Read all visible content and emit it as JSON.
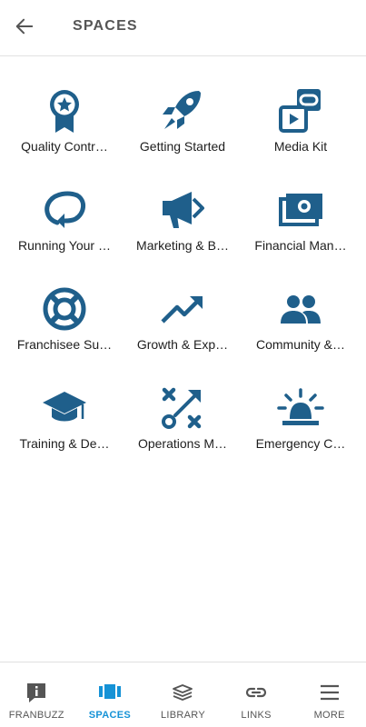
{
  "header": {
    "back_icon": "arrow-left-icon",
    "title": "SPACES"
  },
  "colors": {
    "icon": "#1f5f8b",
    "active_nav": "#1592d6",
    "inactive_nav": "#555555"
  },
  "spaces": [
    {
      "label": "Quality Contr…",
      "icon": "award-ribbon-icon"
    },
    {
      "label": "Getting Started",
      "icon": "rocket-icon"
    },
    {
      "label": "Media Kit",
      "icon": "media-link-icon"
    },
    {
      "label": "Running Your …",
      "icon": "circular-arrow-icon"
    },
    {
      "label": "Marketing & B…",
      "icon": "megaphone-icon"
    },
    {
      "label": "Financial Man…",
      "icon": "money-icon"
    },
    {
      "label": "Franchisee Su…",
      "icon": "lifebuoy-icon"
    },
    {
      "label": "Growth & Exp…",
      "icon": "trending-up-icon"
    },
    {
      "label": "Community &…",
      "icon": "people-icon"
    },
    {
      "label": "Training & De…",
      "icon": "graduation-cap-icon"
    },
    {
      "label": "Operations M…",
      "icon": "strategy-play-icon"
    },
    {
      "label": "Emergency C…",
      "icon": "siren-icon"
    }
  ],
  "bottom_nav": [
    {
      "label": "FRANBUZZ",
      "icon": "info-chat-icon",
      "active": false
    },
    {
      "label": "SPACES",
      "icon": "spaces-icon",
      "active": true
    },
    {
      "label": "LIBRARY",
      "icon": "stack-icon",
      "active": false
    },
    {
      "label": "LINKS",
      "icon": "link-icon",
      "active": false
    },
    {
      "label": "MORE",
      "icon": "menu-icon",
      "active": false
    }
  ]
}
